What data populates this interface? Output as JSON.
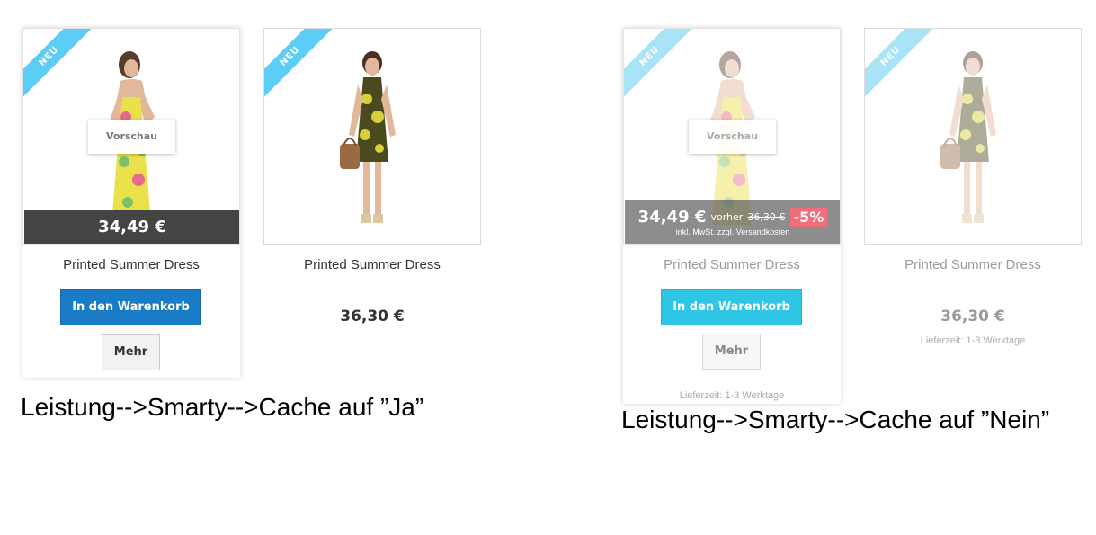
{
  "left_panel": {
    "caption": "Leistung-->Smarty-->Cache auf ”Ja”",
    "products": [
      {
        "badge": "NEU",
        "preview_label": "Vorschau",
        "price": "34,49 €",
        "name": "Printed Summer Dress",
        "cart_label": "In den Warenkorb",
        "more_label": "Mehr"
      },
      {
        "badge": "NEU",
        "name": "Printed Summer Dress",
        "price": "36,30 €"
      }
    ]
  },
  "right_panel": {
    "caption": "Leistung-->Smarty-->Cache auf ”Nein”",
    "products": [
      {
        "badge": "NEU",
        "preview_label": "Vorschau",
        "price": "34,49 €",
        "old_price_prefix": "vorher",
        "old_price": "36,30 €",
        "discount": "-5%",
        "tax_note": "inkl. MwSt.",
        "shipping_link": "zzgl. Versandkosten",
        "name": "Printed Summer Dress",
        "cart_label": "In den Warenkorb",
        "more_label": "Mehr",
        "delivery": "Lieferzeit: 1-3 Werktage"
      },
      {
        "badge": "NEU",
        "name": "Printed Summer Dress",
        "price": "36,30 €",
        "delivery": "Lieferzeit: 1-3 Werktage"
      }
    ]
  },
  "colors": {
    "ribbon": "#5ccdf5",
    "cart_button_cached": "#1a7bc6",
    "cart_button_uncached": "#2ec5e6",
    "discount_badge": "#f06e7c",
    "price_bar": "#444444"
  }
}
